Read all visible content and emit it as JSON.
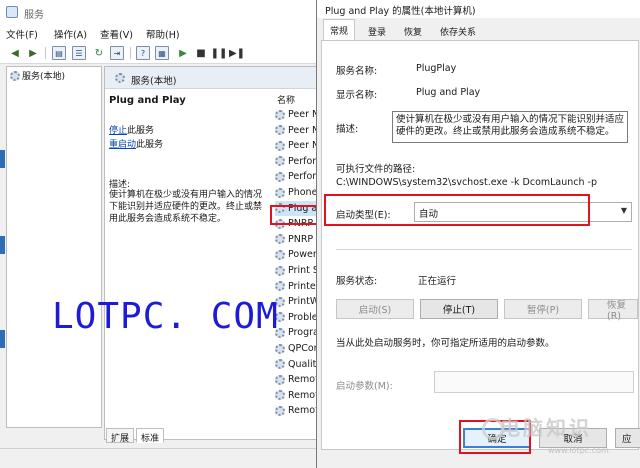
{
  "services_window": {
    "title": "服务",
    "menu": [
      "文件(F)",
      "操作(A)",
      "查看(V)",
      "帮助(H)"
    ],
    "toolbar_icons": [
      "back-arrow-icon",
      "forward-arrow-icon",
      "console-tree-icon",
      "list-view-icon",
      "refresh-icon",
      "export-icon",
      "help-icon",
      "properties-icon",
      "play-icon",
      "stop-icon",
      "pause-icon",
      "restart-icon"
    ],
    "tree_root": "服务(本地)",
    "pane_header": "服务(本地)",
    "selected_service": "Plug and Play",
    "stop_link": "停止",
    "stop_suffix": "此服务",
    "restart_link": "重启动",
    "restart_suffix": "此服务",
    "description_label": "描述:",
    "description_text": "使计算机在极少或没有用户输入的情况下能识别并适应硬件的更改。终止或禁用此服务会造成系统不稳定。",
    "column_name": "名称",
    "services": [
      "Peer N",
      "Peer N",
      "Peer N",
      "Perfor",
      "Perfor",
      "Phone",
      "Plug a",
      "PNRP",
      "PNRP",
      "Power",
      "Print S",
      "Printer",
      "PrintW",
      "Proble",
      "Progra",
      "QPCor",
      "Quality",
      "Remot",
      "Remot",
      "Remot"
    ],
    "bottom_tabs": [
      "扩展",
      "标准"
    ]
  },
  "watermark": "LOTPC. COM",
  "dialog": {
    "title": "Plug and Play 的属性(本地计算机)",
    "tabs": [
      "常规",
      "登录",
      "恢复",
      "依存关系"
    ],
    "service_name_label": "服务名称:",
    "service_name": "PlugPlay",
    "display_name_label": "显示名称:",
    "display_name": "Plug and Play",
    "description_label": "描述:",
    "description": "使计算机在极少或没有用户输入的情况下能识别并适应硬件的更改。终止或禁用此服务会造成系统不稳定。",
    "exe_path_label": "可执行文件的路径:",
    "exe_path": "C:\\WINDOWS\\system32\\svchost.exe -k DcomLaunch -p",
    "startup_type_label": "启动类型(E):",
    "startup_type": "自动",
    "status_label": "服务状态:",
    "status_value": "正在运行",
    "buttons": {
      "start": "启动(S)",
      "stop": "停止(T)",
      "pause": "暂停(P)",
      "resume": "恢复(R)"
    },
    "start_hint": "当从此处启动服务时，你可指定所适用的启动参数。",
    "start_params_label": "启动参数(M):",
    "ok": "确定",
    "cancel": "取消",
    "apply": "应"
  },
  "brand_watermark": {
    "text": "电脑知识",
    "url": "www.lotpc.com"
  },
  "colors": {
    "highlight_red": "#e0141e",
    "link_blue": "#0645ad",
    "selection": "#cce4f7",
    "watermark_blue": "#1d1bd8"
  }
}
